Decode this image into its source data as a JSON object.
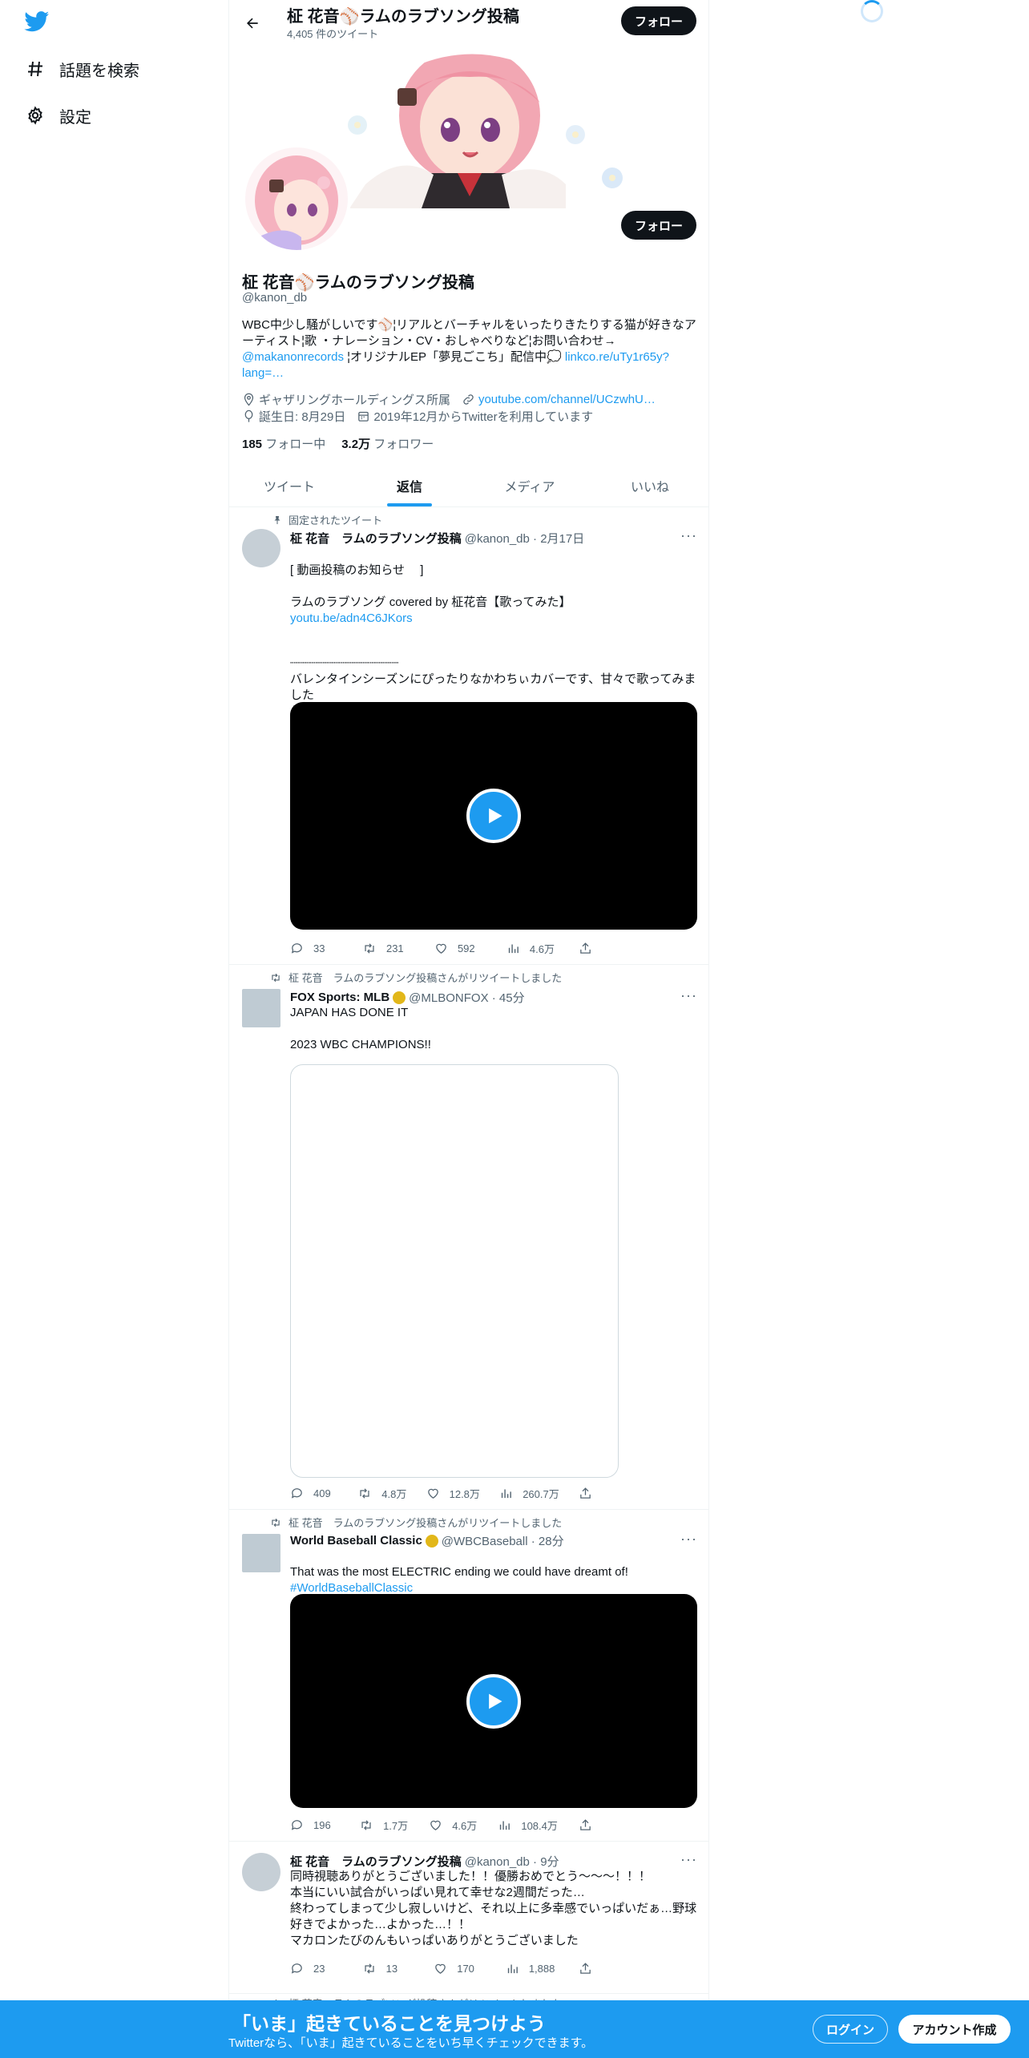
{
  "nav": {
    "explore_label": "話題を検索",
    "settings_label": "設定"
  },
  "header": {
    "title": "柾 花音⚾ラムのラブソング投稿",
    "tweet_count": "4,405 件のツイート",
    "follow_label": "フォロー"
  },
  "profile": {
    "follow_label": "フォロー",
    "name": "柾 花音⚾ラムのラブソング投稿",
    "handle": "@kanon_db",
    "bio_1": "WBC中少し騒がしいです⚾¦リアルとバーチャルをいったりきたりする猫が好きなアーティスト¦歌 ・ナレーション・CV・おしゃべりなど¦お問い合わせ→",
    "bio_link_1": "@makanonrecords",
    "bio_2": "¦オリジナルEP「夢見ごこち」配信中💭",
    "bio_link_2": "linkco.re/uTy1r65y?lang=…",
    "location": "ギャザリングホールディングス所属",
    "url": "youtube.com/channel/UCzwhU…",
    "birthday": "誕生日: 8月29日",
    "joined": "2019年12月からTwitterを利用しています",
    "following_count": "185",
    "following_label": "フォロー中",
    "followers_count": "3.2万",
    "followers_label": "フォロワー"
  },
  "tabs": [
    {
      "label": "ツイート"
    },
    {
      "label": "返信"
    },
    {
      "label": "メディア"
    },
    {
      "label": "いいね"
    }
  ],
  "tweets": [
    {
      "social": "固定されたツイート",
      "name": "柾 花音　ラムのラブソング投稿",
      "meta": "@kanon_db · 2月17日",
      "text_1": "[ 動画投稿のお知らせ　 ]\n\nラムのラブソング covered by 柾花音【歌ってみた】",
      "link": "youtu.be/adn4C6JKors",
      "text_2": "┈┈┈┈┈┈┈┈┈┈┈┈┈┈┈\nバレンタインシーズンにぴったりなかわちぃカバーです、甘々で歌ってみました\nうっふん( ´ ˘ ` )",
      "replies": "33",
      "retweets": "231",
      "likes": "592",
      "views": "4.6万"
    },
    {
      "social": "柾 花音　ラムのラブソング投稿さんがリツイートしました",
      "name": "FOX Sports: MLB",
      "meta": "@MLBONFOX · 45分",
      "text_1": "JAPAN HAS DONE IT\n\n2023 WBC CHAMPIONS!!",
      "replies": "409",
      "retweets": "4.8万",
      "likes": "12.8万",
      "views": "260.7万"
    },
    {
      "social": "柾 花音　ラムのラブソング投稿さんがリツイートしました",
      "name": "World Baseball Classic",
      "meta": "@WBCBaseball · 28分",
      "text_1": "That was the most ELECTRIC ending we could have dreamt of!",
      "link": "#WorldBaseballClassic",
      "replies": "196",
      "retweets": "1.7万",
      "likes": "4.6万",
      "views": "108.4万"
    },
    {
      "name": "柾 花音　ラムのラブソング投稿",
      "meta": "@kanon_db · 9分",
      "text_1": "同時視聴ありがとうございました！！優勝おめでとう〜〜〜！！！\n本当にいい試合がいっぱい見れて幸せな2週間だった…\n終わってしまって少し寂しいけど、それ以上に多幸感でいっぱいだぁ…野球好きでよかった…よかった…！！\nマカロンたびのんもいっぱいありがとうございました",
      "replies": "23",
      "retweets": "13",
      "likes": "170",
      "views": "1,888"
    },
    {
      "social": "柾 花音　ラムのラブソング投稿さんがリツイートしました"
    }
  ],
  "bottom_bar": {
    "title": "「いま」起きていることを見つけよう",
    "subtitle": "Twitterなら、「いま」起きていることをいち早くチェックできます。",
    "login_label": "ログイン",
    "signup_label": "アカウント作成"
  },
  "colors": {
    "accent": "#1d9bf0",
    "text": "#0f1419",
    "muted": "#536471"
  }
}
